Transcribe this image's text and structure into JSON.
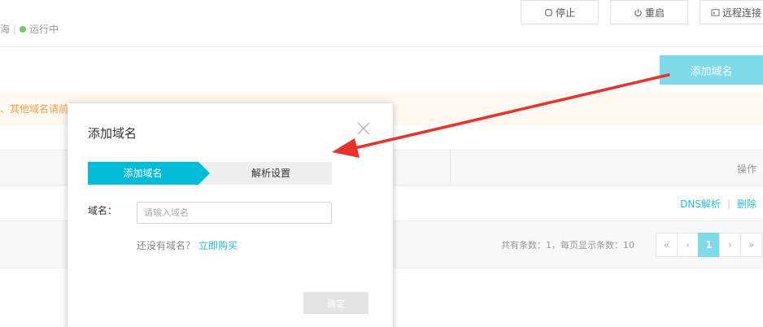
{
  "header": {
    "region": "海",
    "status": "运行中",
    "buttons": {
      "stop": "停止",
      "restart": "重启",
      "remote": "远程连接"
    }
  },
  "toolbar": {
    "add_domain": "添加域名"
  },
  "notice": {
    "text": "、其他域名请前往"
  },
  "table": {
    "op_header": "操作",
    "row_links": {
      "dns": "DNS解析",
      "delete": "删除"
    }
  },
  "pagination": {
    "summary": "共有条数：1，每页显示条数：10",
    "first": "«",
    "prev": "‹",
    "current": "1",
    "next": "›",
    "last": "»"
  },
  "modal": {
    "title": "添加域名",
    "steps": [
      "添加域名",
      "解析设置"
    ],
    "field_label": "域名：",
    "field_placeholder": "请输入域名",
    "no_domain_text": "还没有域名？",
    "buy_link": "立即购买",
    "confirm": "确定"
  },
  "colors": {
    "accent": "#00bcd8",
    "accent_light": "#7ed9eb",
    "notice_text": "#f0a050",
    "annotation": "#e8322b"
  }
}
